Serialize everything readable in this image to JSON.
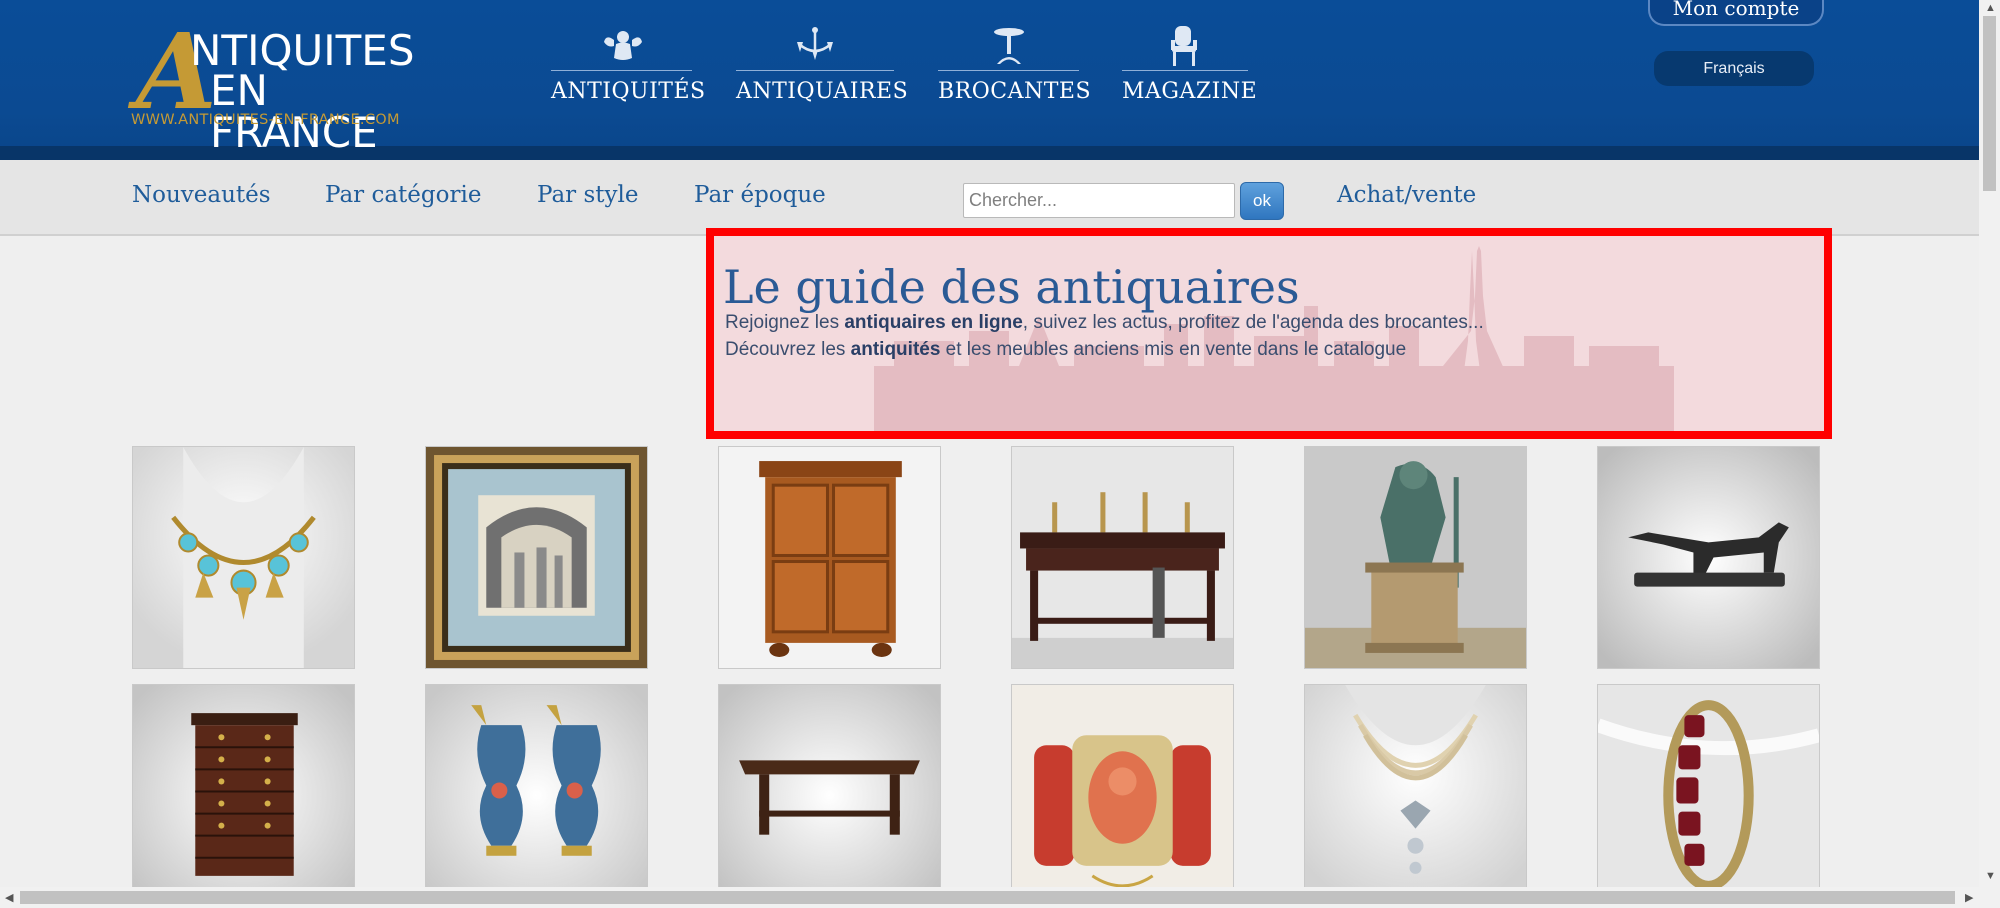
{
  "header": {
    "logo": {
      "line1": "NTIQUITES",
      "line2": "EN FRANCE",
      "url": "WWW.ANTIQUITES-EN-FRANCE.COM",
      "initial": "A"
    },
    "nav": [
      {
        "label": "ANTIQUITÉS",
        "icon": "cherub-icon"
      },
      {
        "label": "ANTIQUAIRES",
        "icon": "chandelier-icon"
      },
      {
        "label": "BROCANTES",
        "icon": "table-icon"
      },
      {
        "label": "MAGAZINE",
        "icon": "armchair-icon"
      }
    ],
    "account_label": "Mon compte",
    "language_label": "Français"
  },
  "subnav": {
    "items": [
      "Nouveautés",
      "Par catégorie",
      "Par style",
      "Par époque"
    ],
    "search_placeholder": "Chercher...",
    "ok_label": "ok",
    "achat_label": "Achat/vente"
  },
  "hero": {
    "title": "Le guide des antiquaires",
    "line1_pre": "Rejoignez les ",
    "line1_bold": "antiquaires en ligne",
    "line1_post": ", suivez les actus, profitez de l'agenda des brocantes...",
    "line2_pre": "Découvrez les ",
    "line2_bold": "antiquités",
    "line2_post": " et les meubles anciens mis en vente dans le catalogue"
  },
  "products": [
    {
      "name": "necklace-turquoise"
    },
    {
      "name": "framed-engraving"
    },
    {
      "name": "wooden-cabinet"
    },
    {
      "name": "console-candlesticks"
    },
    {
      "name": "bronze-statue"
    },
    {
      "name": "bronze-dog"
    },
    {
      "name": "chest-of-drawers"
    },
    {
      "name": "enamel-ewers"
    },
    {
      "name": "farm-table"
    },
    {
      "name": "coral-bracelet"
    },
    {
      "name": "pearl-necklace"
    },
    {
      "name": "garnet-ring"
    }
  ],
  "colors": {
    "header_blue": "#0a4d98",
    "gold": "#c59a35",
    "link_blue": "#1f5c9a",
    "highlight_red": "#ff0000"
  }
}
